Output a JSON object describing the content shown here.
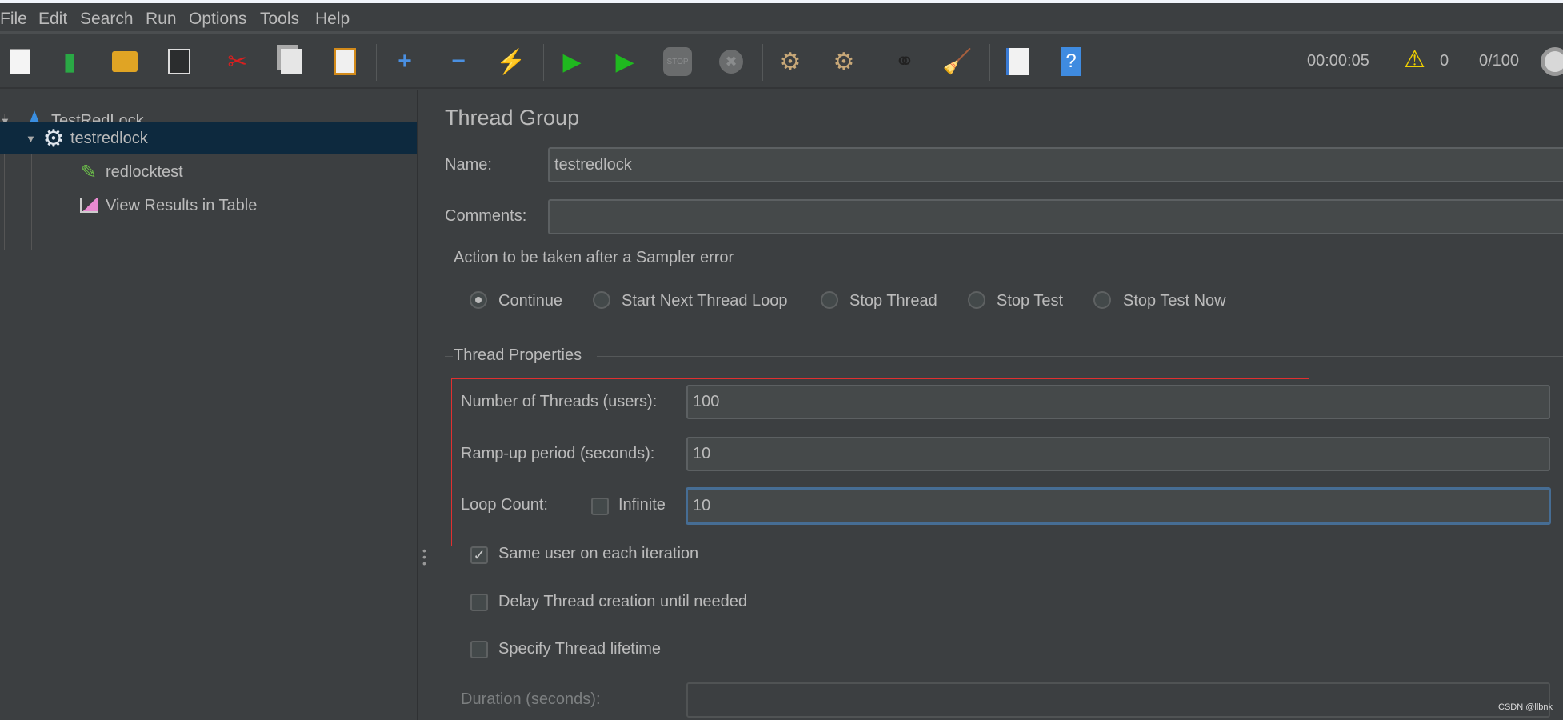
{
  "menu": [
    "File",
    "Edit",
    "Search",
    "Run",
    "Options",
    "Tools",
    "Help"
  ],
  "toolbar": {
    "icons": [
      "new-icon",
      "templates-icon",
      "open-icon",
      "save-icon",
      "cut-icon",
      "copy-icon",
      "paste-icon",
      "expand-icon",
      "collapse-icon",
      "toggle-icon",
      "start-icon",
      "start-no-pause-icon",
      "stop-icon",
      "shutdown-icon",
      "clear-icon",
      "clear-all-icon",
      "search-icon",
      "reset-search-icon",
      "function-helper-icon",
      "help-icon"
    ],
    "timer": "00:00:05",
    "warnings": "0",
    "threads": "0/100"
  },
  "tree": {
    "items": [
      {
        "label": "TestRedLock",
        "icon": "test-plan-flask-icon"
      },
      {
        "label": "testredlock",
        "icon": "thread-group-gear-icon",
        "selected": true
      },
      {
        "label": "redlocktest",
        "icon": "sampler-pipette-icon"
      },
      {
        "label": "View Results in Table",
        "icon": "listener-chart-icon"
      }
    ]
  },
  "panel": {
    "title": "Thread Group",
    "name_label": "Name:",
    "name_value": "testredlock",
    "comments_label": "Comments:",
    "comments_value": "",
    "action_title": "Action to be taken after a Sampler error",
    "actions": [
      {
        "label": "Continue",
        "selected": true
      },
      {
        "label": "Start Next Thread Loop"
      },
      {
        "label": "Stop Thread"
      },
      {
        "label": "Stop Test"
      },
      {
        "label": "Stop Test Now"
      }
    ],
    "props_title": "Thread Properties",
    "threads_label": "Number of Threads (users):",
    "threads_value": "100",
    "rampup_label": "Ramp-up period (seconds):",
    "rampup_value": "10",
    "loop_label": "Loop Count:",
    "infinite_label": "Infinite",
    "infinite_checked": false,
    "loop_value": "10",
    "same_user_label": "Same user on each iteration",
    "same_user_checked": true,
    "delay_label": "Delay Thread creation until needed",
    "delay_checked": false,
    "lifetime_label": "Specify Thread lifetime",
    "lifetime_checked": false,
    "duration_label": "Duration (seconds):",
    "duration_value": ""
  },
  "watermark": "CSDN @llbnk",
  "colors": {
    "background": "#3c3f41",
    "selection": "#0d293e",
    "highlight_box": "#e03030",
    "focus": "#466d94"
  }
}
